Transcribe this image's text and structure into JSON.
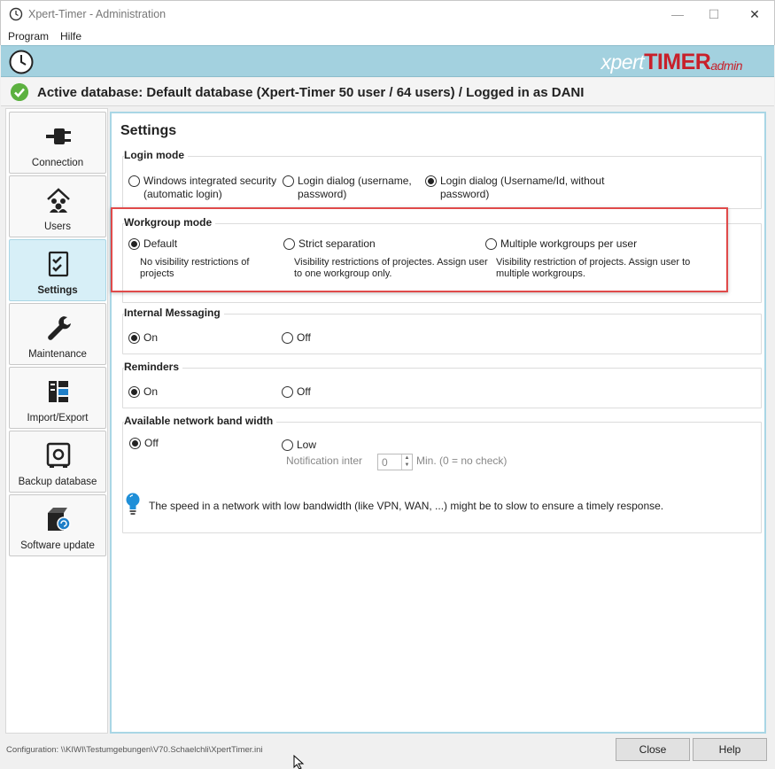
{
  "window": {
    "title": "Xpert-Timer - Administration",
    "minimize": "—",
    "maximize": "☐",
    "close": "✕"
  },
  "menu": {
    "program": "Program",
    "help": "Hilfe"
  },
  "logo": {
    "xpert": "xpert",
    "timer": "TIMER",
    "admin": "admin"
  },
  "status": {
    "text": "Active database: Default database (Xpert-Timer 50 user / 64 users) / Logged in as DANI"
  },
  "nav": {
    "items": [
      {
        "label": "Connection",
        "icon": "plug-icon"
      },
      {
        "label": "Users",
        "icon": "users-icon"
      },
      {
        "label": "Settings",
        "icon": "checklist-icon",
        "active": true
      },
      {
        "label": "Maintenance",
        "icon": "wrench-icon"
      },
      {
        "label": "Import/Export",
        "icon": "import-export-icon"
      },
      {
        "label": "Backup database",
        "icon": "safe-icon"
      },
      {
        "label": "Software update",
        "icon": "software-update-icon"
      }
    ]
  },
  "settings": {
    "title": "Settings",
    "login_mode": {
      "title": "Login mode",
      "opt1": "Windows integrated security (automatic login)",
      "opt2": "Login dialog (username, password)",
      "opt3": "Login dialog (Username/Id, without password)",
      "selected": 3
    },
    "workgroup_mode": {
      "title": "Workgroup mode",
      "opt1": "Default",
      "desc1": "No visibility restrictions of projects",
      "opt2": "Strict separation",
      "desc2": "Visibility restrictions of projectes. Assign user to one workgroup only.",
      "opt3": "Multiple workgroups per user",
      "desc3": "Visibility restriction of projects. Assign user to multiple workgroups.",
      "selected": 1
    },
    "internal_messaging": {
      "title": "Internal Messaging",
      "on": "On",
      "off": "Off",
      "selected": "on"
    },
    "reminders": {
      "title": "Reminders",
      "on": "On",
      "off": "Off",
      "selected": "on"
    },
    "bandwidth": {
      "title": "Available network band width",
      "off": "Off",
      "low": "Low",
      "selected": "off",
      "notification_label": "Notification inter",
      "notification_value": "0",
      "notification_unit": "Min. (0 = no check)",
      "tip": "The speed in a network with low bandwidth (like VPN, WAN, ...) might be to slow to ensure a timely response."
    }
  },
  "footer": {
    "config": "Configuration: \\\\KIWI\\Testumgebungen\\V70.Schaelchli\\XpertTimer.ini",
    "close": "Close",
    "help": "Help"
  },
  "colors": {
    "banner": "#a3d1df",
    "accent_border": "#a9d6e5",
    "highlight": "#e04a4a",
    "status_ok": "#5cb140"
  }
}
